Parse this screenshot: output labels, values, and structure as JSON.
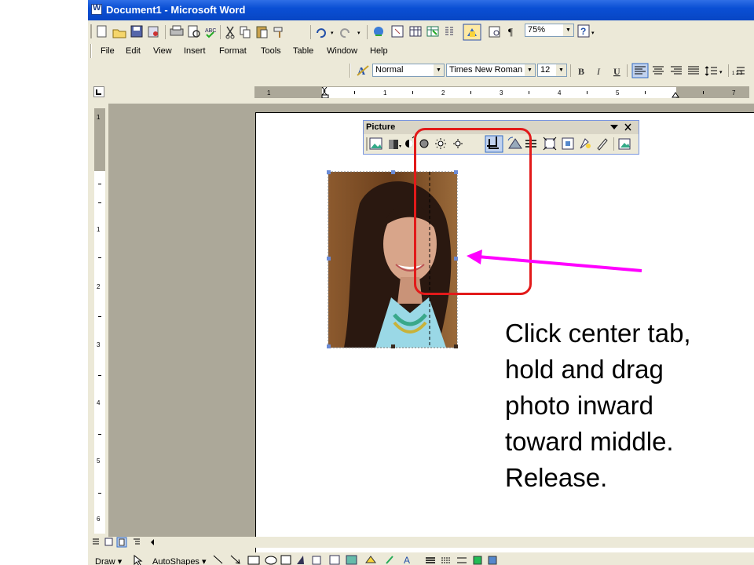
{
  "window": {
    "title": "Document1 - Microsoft Word"
  },
  "menu": {
    "items": [
      "File",
      "Edit",
      "View",
      "Insert",
      "Format",
      "Tools",
      "Table",
      "Window",
      "Help"
    ]
  },
  "standard_toolbar": {
    "zoom": "75%"
  },
  "formatting_toolbar": {
    "style": "Normal",
    "font": "Times New Roman",
    "size": "12"
  },
  "ruler": {
    "h_labels": [
      "1",
      "1",
      "2",
      "3",
      "4",
      "5",
      "7"
    ],
    "v_labels": [
      "1",
      "1",
      "2",
      "3",
      "4",
      "5",
      "6"
    ]
  },
  "picture_toolbar": {
    "title": "Picture"
  },
  "drawing_toolbar": {
    "draw_label": "Draw ▾",
    "autoshapes_label": "AutoShapes ▾"
  },
  "annotation": {
    "lines": [
      "Click center tab,",
      "hold and drag",
      "photo inward",
      "toward middle.",
      "Release."
    ],
    "highlight_color": "#e21a1a",
    "arrow_color": "#ff00ff"
  },
  "icons": [
    "new-icon",
    "open-icon",
    "save-icon",
    "permission-icon",
    "print-icon",
    "print-preview-icon",
    "spelling-icon",
    "cut-icon",
    "copy-icon",
    "paste-icon",
    "format-painter-icon",
    "undo-icon",
    "redo-icon",
    "hyperlink-icon",
    "tables-borders-icon",
    "insert-table-icon",
    "insert-excel-icon",
    "columns-icon",
    "drawing-icon",
    "document-map-icon",
    "show-hide-icon",
    "help-icon"
  ]
}
